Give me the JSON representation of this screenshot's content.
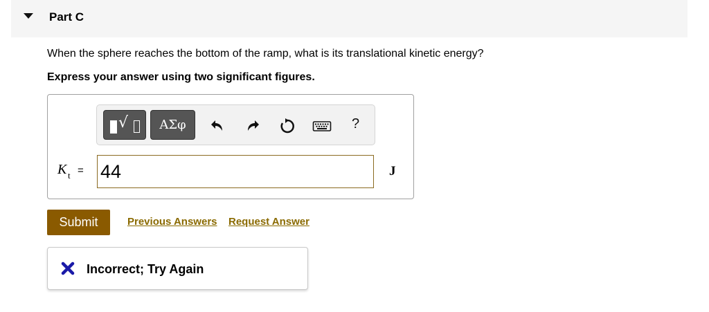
{
  "part": {
    "title": "Part C",
    "caret_icon": "triangle-down-icon"
  },
  "question": "When the sphere reaches the bottom of the ramp, what is its translational kinetic energy?",
  "instruction": "Express your answer using two significant figures.",
  "toolbar": {
    "templates_icon": "templates-icon",
    "symbols_label": "ΑΣφ",
    "undo_icon": "undo-icon",
    "redo_icon": "redo-icon",
    "reset_icon": "reset-icon",
    "keyboard_icon": "keyboard-icon",
    "help_label": "?"
  },
  "answer": {
    "variable": "K",
    "subscript": "t",
    "equals": "=",
    "value": "44",
    "unit": "J"
  },
  "actions": {
    "submit_label": "Submit",
    "previous_answers": "Previous Answers",
    "request_answer": "Request Answer"
  },
  "feedback": {
    "icon": "x-icon",
    "text": "Incorrect; Try Again",
    "icon_color": "#1a1aa8"
  },
  "colors": {
    "accent": "#8a5a00",
    "link": "#8a6a00",
    "header_bg": "#f5f5f5"
  }
}
